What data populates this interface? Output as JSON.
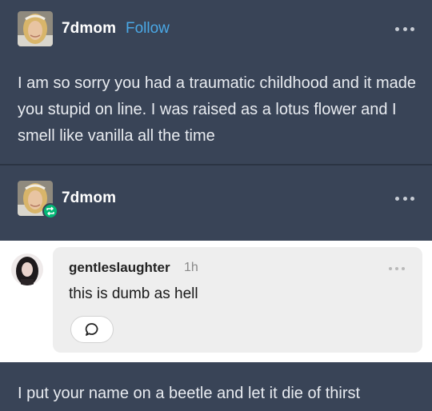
{
  "post1": {
    "username": "7dmom",
    "follow_label": "Follow",
    "more_icon": "ellipsis-icon",
    "text": "I am so sorry you had a traumatic childhood and it made you stupid on line. I was raised as a lotus flower and I smell like vanilla all the time"
  },
  "post2": {
    "username": "7dmom",
    "reblog_icon": "reblog-icon",
    "more_icon": "ellipsis-icon"
  },
  "comment": {
    "username": "gentleslaughter",
    "time": "1h",
    "text": "this is dumb as hell",
    "reply_icon": "speech-bubble-icon",
    "more_icon": "ellipsis-icon"
  },
  "post3": {
    "text": "I put your name on a beetle and let it die of thirst"
  },
  "colors": {
    "background": "#394457",
    "follow": "#4aa8e6",
    "reblog_badge": "#02b875"
  }
}
